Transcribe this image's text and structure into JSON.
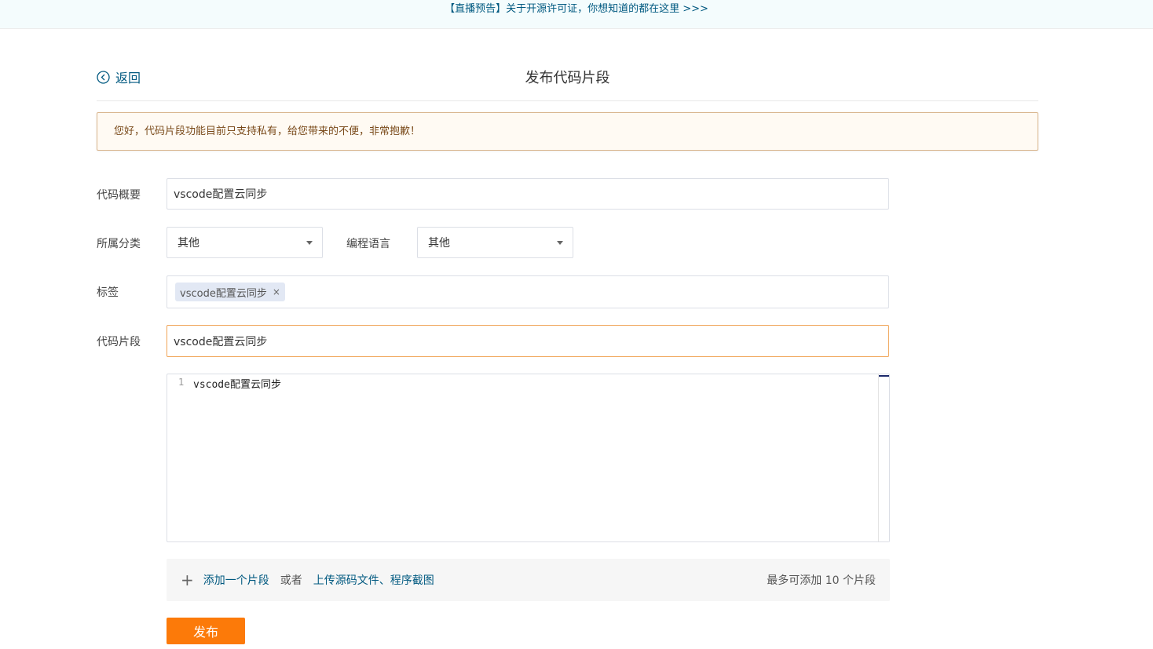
{
  "banner": {
    "text": "【直播预告】关于开源许可证，你想知道的都在这里 >>>"
  },
  "header": {
    "back_label": "返回",
    "title": "发布代码片段"
  },
  "notice": {
    "text": "您好，代码片段功能目前只支持私有，给您带来的不便，非常抱歉！"
  },
  "form": {
    "summary": {
      "label": "代码概要",
      "value": "vscode配置云同步"
    },
    "category": {
      "label": "所属分类",
      "selected": "其他"
    },
    "language": {
      "label": "编程语言",
      "selected": "其他"
    },
    "tags": {
      "label": "标签",
      "items": [
        "vscode配置云同步"
      ],
      "remove_symbol": "×"
    },
    "snippet": {
      "label": "代码片段",
      "filename": "vscode配置云同步"
    },
    "editor": {
      "line_number": "1",
      "code": "vscode配置云同步"
    }
  },
  "addbar": {
    "plus": "+",
    "add_label": "添加一个片段",
    "or_label": "或者",
    "upload_label": "上传源码文件、程序截图",
    "limit_text": "最多可添加 10 个片段"
  },
  "publish": {
    "label": "发布"
  },
  "colors": {
    "accent": "#fc7a09",
    "link": "#005980",
    "notice_border": "#d8b48c"
  }
}
